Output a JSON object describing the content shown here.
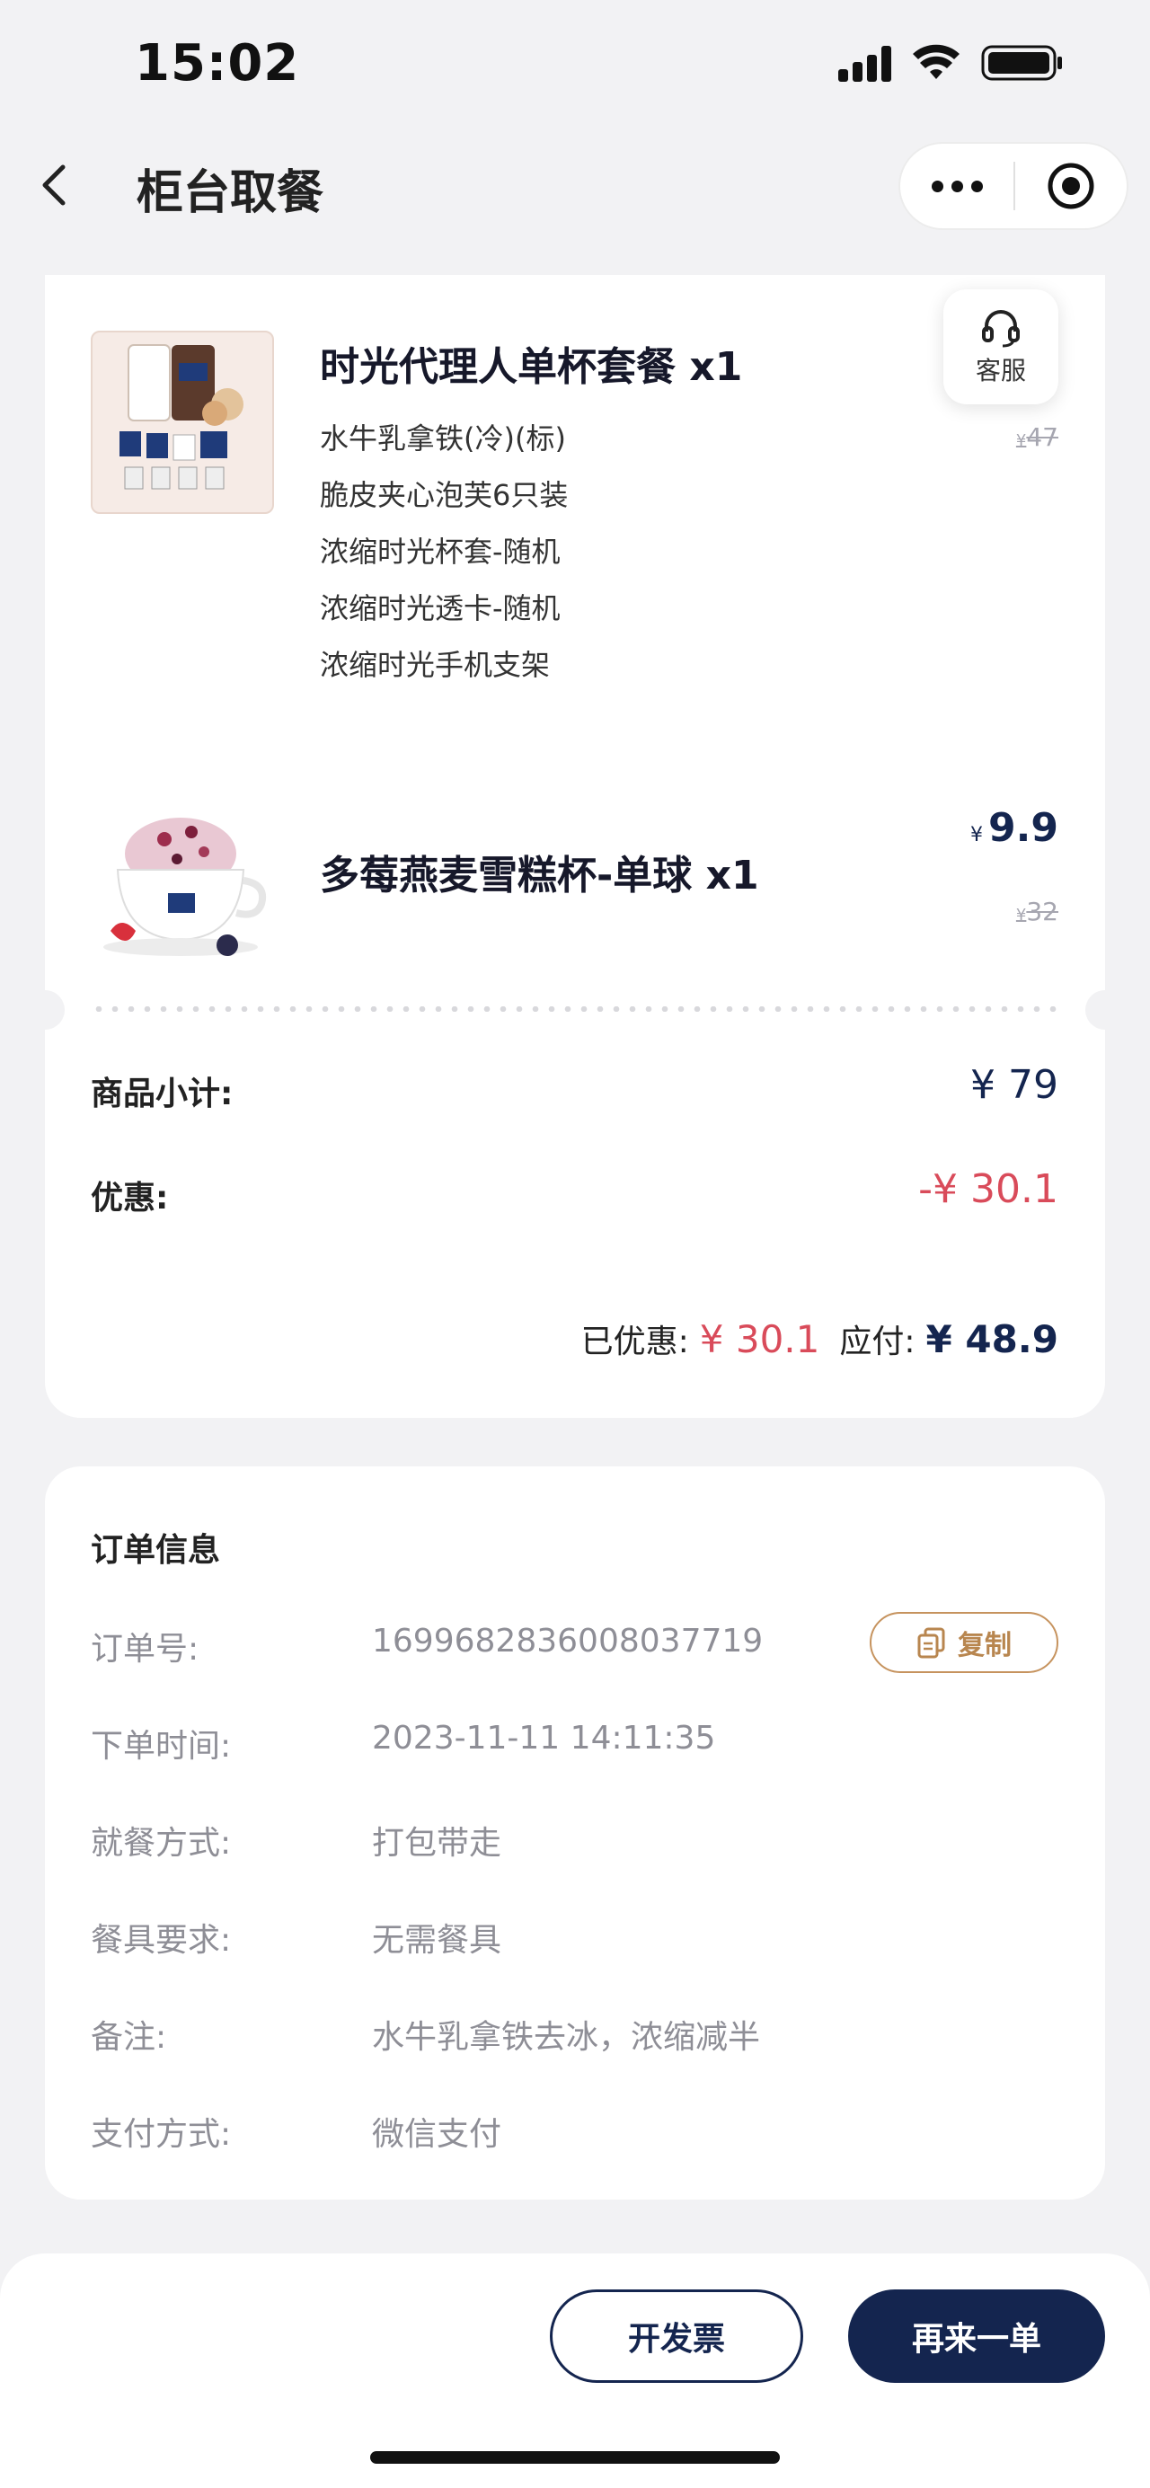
{
  "status_bar": {
    "time": "15:02"
  },
  "nav": {
    "title": "柜台取餐"
  },
  "service": {
    "label": "客服"
  },
  "items": [
    {
      "name": "时光代理人单杯套餐 x1",
      "subitems": [
        "水牛乳拿铁(冷)(标)",
        "脆皮夹心泡芙6只装",
        "浓缩时光杯套-随机",
        "浓缩时光透卡-随机",
        "浓缩时光手机支架"
      ],
      "original_price_currency": "¥",
      "original_price": "47"
    },
    {
      "name": "多莓燕麦雪糕杯-单球 x1",
      "price_currency": "¥",
      "price": "9.9",
      "original_price_currency": "¥",
      "original_price": "32"
    }
  ],
  "totals": {
    "subtotal_label": "商品小计:",
    "subtotal_value": "¥ 79",
    "discount_label": "优惠:",
    "discount_value": "-¥ 30.1",
    "saved_label": "已优惠:",
    "saved_value": "¥ 30.1",
    "payable_label": "应付:",
    "payable_value": "¥ 48.9"
  },
  "order_info": {
    "title": "订单信息",
    "copy_label": "复制",
    "rows": [
      {
        "key": "订单号:",
        "value": "1699682836008037719"
      },
      {
        "key": "下单时间:",
        "value": "2023-11-11 14:11:35"
      },
      {
        "key": "就餐方式:",
        "value": "打包带走"
      },
      {
        "key": "餐具要求:",
        "value": "无需餐具"
      },
      {
        "key": "备注:",
        "value": "水牛乳拿铁去冰，浓缩减半"
      },
      {
        "key": "支付方式:",
        "value": "微信支付"
      }
    ]
  },
  "actions": {
    "invoice_label": "开发票",
    "reorder_label": "再来一单"
  },
  "colors": {
    "brand_navy": "#14254f",
    "discount_red": "#d94b5a",
    "copy_gold": "#b8864f",
    "background": "#f2f2f4"
  }
}
